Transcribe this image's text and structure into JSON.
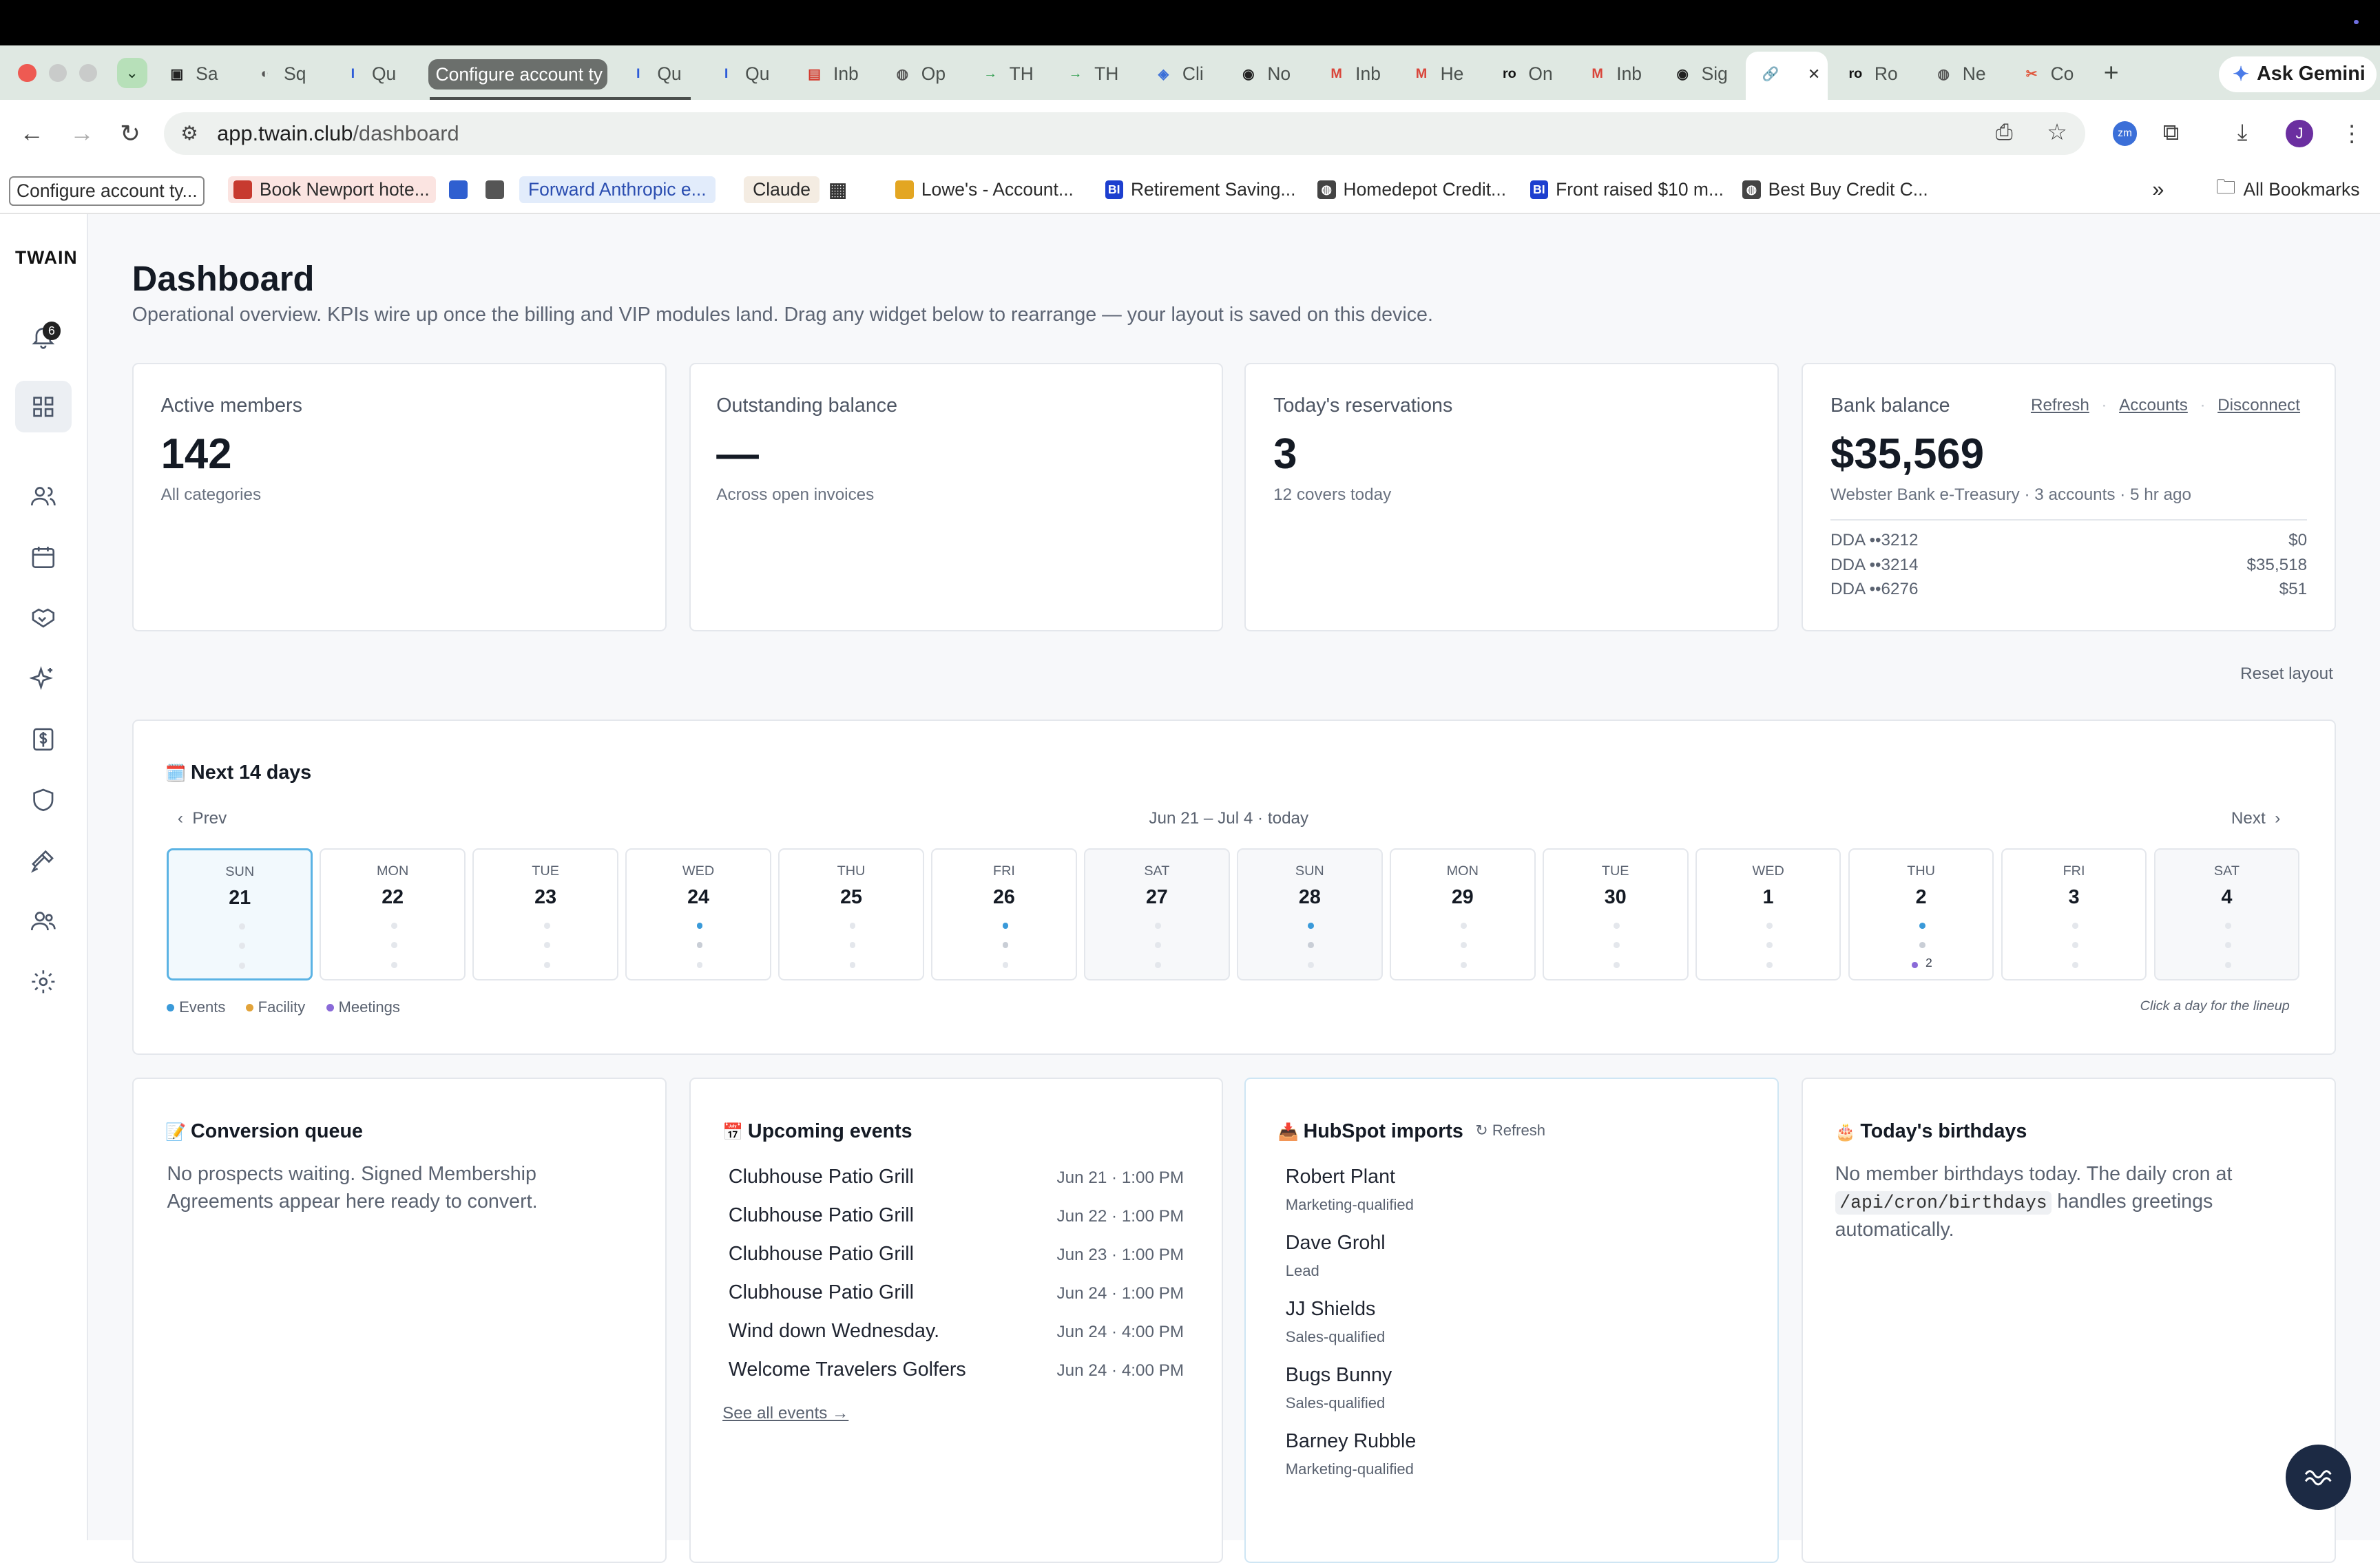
{
  "browser": {
    "tabs": [
      {
        "label": "Sa",
        "color": "#222222",
        "glyph": "▣"
      },
      {
        "label": "Sq",
        "color": "#555555",
        "glyph": "◐"
      },
      {
        "label": "Qu",
        "color": "#2d5bd8",
        "glyph": "I"
      },
      {
        "label": "Configure account ty",
        "active": true
      },
      {
        "label": "Qu",
        "color": "#2d5bd8",
        "glyph": "I"
      },
      {
        "label": "Qu",
        "color": "#2d5bd8",
        "glyph": "I"
      },
      {
        "label": "Inb",
        "color": "#d33b2f",
        "glyph": "▤"
      },
      {
        "label": "Op",
        "color": "#555555",
        "glyph": "◍"
      },
      {
        "label": "TH",
        "color": "#2b9b4b",
        "glyph": "→"
      },
      {
        "label": "TH",
        "color": "#2b9b4b",
        "glyph": "→"
      },
      {
        "label": "Cli",
        "color": "#3b6fd8",
        "glyph": "◈"
      },
      {
        "label": "No",
        "color": "#222222",
        "glyph": "◉"
      },
      {
        "label": "Inb",
        "color": "#d9453a",
        "glyph": "M"
      },
      {
        "label": "He",
        "color": "#d9453a",
        "glyph": "M"
      },
      {
        "label": "On",
        "color": "#111111",
        "glyph": "ro"
      },
      {
        "label": "Inb",
        "color": "#d9453a",
        "glyph": "M"
      },
      {
        "label": "Sig",
        "color": "#222222",
        "glyph": "◉"
      },
      {
        "label": "",
        "color": "#333333",
        "glyph": "🔗",
        "current": true
      },
      {
        "label": "Ro",
        "color": "#111111",
        "glyph": "ro"
      },
      {
        "label": "Ne",
        "color": "#555555",
        "glyph": "◍"
      },
      {
        "label": "Co",
        "color": "#e0553a",
        "glyph": "✂"
      }
    ],
    "ask_gemini": "Ask Gemini",
    "url_host": "app.twain.club",
    "url_path": "/dashboard",
    "profile_initial": "J",
    "bookmarks": [
      {
        "label": "Configure account ty...",
        "style": "boxed"
      },
      {
        "label": "Book Newport hote...",
        "color": "#c73a2f",
        "style": "red"
      },
      {
        "label": "",
        "color": "#2f5fd0"
      },
      {
        "label": "",
        "color": "#555555"
      },
      {
        "label": "Forward Anthropic e...",
        "style": "blue"
      },
      {
        "label": "Claude",
        "style": "tan"
      },
      {
        "label": "",
        "glyph": "▦"
      },
      {
        "label": "Lowe's - Account...",
        "color": "#e3a622"
      },
      {
        "label": "Retirement Saving...",
        "color": "#1d3fcf",
        "glyph": "BI"
      },
      {
        "label": "Homedepot Credit...",
        "color": "#444444",
        "glyph": "◍"
      },
      {
        "label": "Front raised $10 m...",
        "color": "#1d3fcf",
        "glyph": "BI"
      },
      {
        "label": "Best Buy Credit C...",
        "color": "#444444",
        "glyph": "◍"
      }
    ],
    "all_bookmarks": "All Bookmarks",
    "overflow": "»"
  },
  "app": {
    "logo": "TWAIN",
    "notifications_count": "6",
    "nav": [
      "bell",
      "dashboard",
      "members",
      "calendar",
      "partners",
      "sparkles",
      "billing",
      "shield",
      "tools",
      "staff",
      "settings"
    ]
  },
  "header": {
    "title": "Dashboard",
    "subtitle": "Operational overview. KPIs wire up once the billing and VIP modules land. Drag any widget below to rearrange — your layout is saved on this device."
  },
  "kpis": [
    {
      "label": "Active members",
      "value": "142",
      "sub": "All categories"
    },
    {
      "label": "Outstanding balance",
      "value": "—",
      "sub": "Across open invoices"
    },
    {
      "label": "Today's reservations",
      "value": "3",
      "sub": "12 covers today"
    }
  ],
  "bank": {
    "label": "Bank balance",
    "links": [
      "Refresh",
      "Accounts",
      "Disconnect"
    ],
    "value": "$35,569",
    "sub": "Webster Bank e-Treasury · 3 accounts · 5 hr ago",
    "accounts": [
      {
        "name": "DDA ••3212",
        "amount": "$0"
      },
      {
        "name": "DDA ••3214",
        "amount": "$35,518"
      },
      {
        "name": "DDA ••6276",
        "amount": "$51"
      }
    ]
  },
  "reset_layout": "Reset layout",
  "calendar": {
    "emoji": "🗓️",
    "title": "Next 14 days",
    "prev": "Prev",
    "next": "Next",
    "range": "Jun 21 – Jul 4 · today",
    "days": [
      {
        "dow": "SUN",
        "num": "21",
        "today": true,
        "weekend": true,
        "event": false,
        "meetings": ""
      },
      {
        "dow": "MON",
        "num": "22",
        "event": false,
        "meetings": ""
      },
      {
        "dow": "TUE",
        "num": "23",
        "event": false,
        "meetings": ""
      },
      {
        "dow": "WED",
        "num": "24",
        "event": true,
        "meetings": ""
      },
      {
        "dow": "THU",
        "num": "25",
        "event": false,
        "meetings": ""
      },
      {
        "dow": "FRI",
        "num": "26",
        "event": true,
        "meetings": ""
      },
      {
        "dow": "SAT",
        "num": "27",
        "weekend": true,
        "event": false,
        "meetings": ""
      },
      {
        "dow": "SUN",
        "num": "28",
        "weekend": true,
        "event": true,
        "meetings": ""
      },
      {
        "dow": "MON",
        "num": "29",
        "event": false,
        "meetings": ""
      },
      {
        "dow": "TUE",
        "num": "30",
        "event": false,
        "meetings": ""
      },
      {
        "dow": "WED",
        "num": "1",
        "event": false,
        "meetings": ""
      },
      {
        "dow": "THU",
        "num": "2",
        "event": true,
        "meetings": "2"
      },
      {
        "dow": "FRI",
        "num": "3",
        "event": false,
        "meetings": ""
      },
      {
        "dow": "SAT",
        "num": "4",
        "weekend": true,
        "event": false,
        "meetings": ""
      }
    ],
    "legend": [
      {
        "label": "Events",
        "color": "#3a9ad9"
      },
      {
        "label": "Facility",
        "color": "#e2a33a"
      },
      {
        "label": "Meetings",
        "color": "#8a6ad8"
      }
    ],
    "hint": "Click a day for the lineup"
  },
  "conversion": {
    "emoji": "📝",
    "title": "Conversion queue",
    "text": "No prospects waiting. Signed Membership Agreements appear here ready to convert."
  },
  "events": {
    "emoji": "📅",
    "title": "Upcoming events",
    "items": [
      {
        "name": "Clubhouse Patio Grill",
        "when": "Jun 21 · 1:00 PM"
      },
      {
        "name": "Clubhouse Patio Grill",
        "when": "Jun 22 · 1:00 PM"
      },
      {
        "name": "Clubhouse Patio Grill",
        "when": "Jun 23 · 1:00 PM"
      },
      {
        "name": "Clubhouse Patio Grill",
        "when": "Jun 24 · 1:00 PM"
      },
      {
        "name": "Wind down Wednesday.",
        "when": "Jun 24 · 4:00 PM"
      },
      {
        "name": "Welcome Travelers Golfers",
        "when": "Jun 24 · 4:00 PM"
      }
    ],
    "see_all": "See all events →"
  },
  "hubspot": {
    "emoji": "📥",
    "title": "HubSpot imports",
    "refresh": "↻ Refresh",
    "contacts": [
      {
        "name": "Robert Plant",
        "stage": "Marketing-qualified"
      },
      {
        "name": "Dave Grohl",
        "stage": "Lead"
      },
      {
        "name": "JJ Shields",
        "stage": "Sales-qualified"
      },
      {
        "name": "Bugs Bunny",
        "stage": "Sales-qualified"
      },
      {
        "name": "Barney Rubble",
        "stage": "Marketing-qualified"
      }
    ]
  },
  "birthdays": {
    "emoji": "🎂",
    "title": "Today's birthdays",
    "text_before": "No member birthdays today. The daily cron at",
    "code": "/api/cron/birthdays",
    "text_after": "handles greetings automatically."
  }
}
